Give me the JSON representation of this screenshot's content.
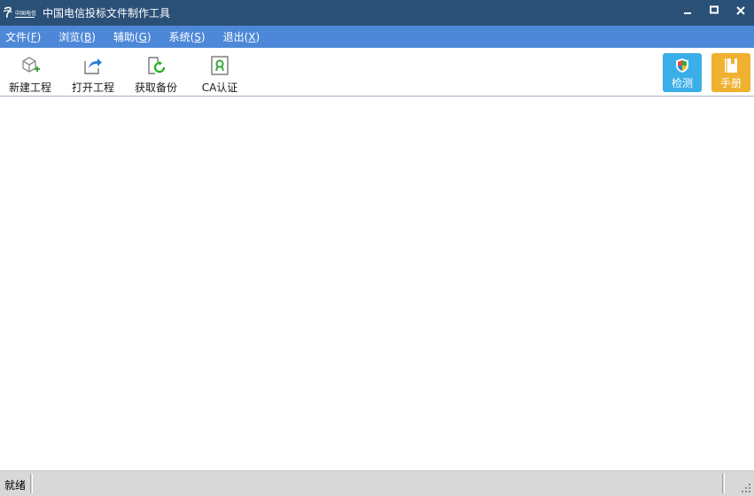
{
  "window": {
    "title": "中国电信投标文件制作工具",
    "minimize_icon": "minimize-icon",
    "maximize_icon": "maximize-icon",
    "close_icon": "close-icon"
  },
  "menu": {
    "items": [
      {
        "label": "文件(",
        "key": "F",
        "close": ")"
      },
      {
        "label": "浏览(",
        "key": "B",
        "close": ")"
      },
      {
        "label": "辅助(",
        "key": "G",
        "close": ")"
      },
      {
        "label": "系统(",
        "key": "S",
        "close": ")"
      },
      {
        "label": "退出(",
        "key": "X",
        "close": ")"
      }
    ]
  },
  "toolbar": {
    "new_project": {
      "label": "新建工程",
      "icon": "new-project-icon"
    },
    "open_project": {
      "label": "打开工程",
      "icon": "open-project-icon"
    },
    "get_backup": {
      "label": "获取备份",
      "icon": "backup-icon"
    },
    "ca_auth": {
      "label": "CA认证",
      "icon": "certificate-icon"
    },
    "check": {
      "label": "检测",
      "icon": "shield-icon"
    },
    "manual": {
      "label": "手册",
      "icon": "book-icon"
    }
  },
  "colors": {
    "titlebar": "#2b5078",
    "menubar": "#4d88d8",
    "check_button": "#3aaee8",
    "manual_button": "#f0b030"
  },
  "status": {
    "text": "就绪"
  }
}
